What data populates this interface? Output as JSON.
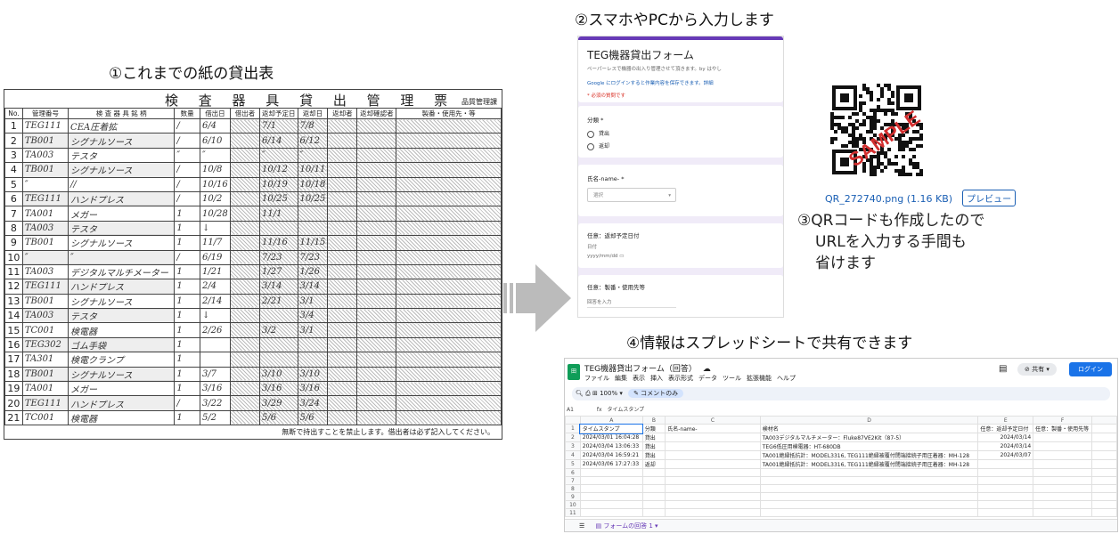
{
  "headings": {
    "paper": "①これまでの紙の貸出表",
    "form": "②スマホやPCから入力します",
    "qr_note": [
      "③QRコードも作成したので",
      "URLを入力する手間も",
      "省けます"
    ],
    "sheet": "④情報はスプレッドシートで共有できます"
  },
  "ledger": {
    "title": "検 査 器 具 貸 出 管 理 票",
    "dept": "品質管理課",
    "columns": [
      "No.",
      "管理番号",
      "検 査 器 具 銘 柄",
      "数量",
      "借出日",
      "借出者",
      "返却予定日",
      "返却日",
      "返却者",
      "返却確認者",
      "製番・使用先・等"
    ],
    "rows": [
      {
        "no": "1",
        "id": "TEG111",
        "item": "CEA圧着拡",
        "qty": "/",
        "date": "6/4",
        "due": "7/1",
        "ret": "7/8"
      },
      {
        "no": "2",
        "id": "TB001",
        "item": "シグナルソース",
        "qty": "/",
        "date": "6/10",
        "due": "6/14",
        "ret": "6/12"
      },
      {
        "no": "3",
        "id": "TA003",
        "item": "テスタ",
        "qty": "″",
        "date": "″",
        "due": "″",
        "ret": "″"
      },
      {
        "no": "4",
        "id": "TB001",
        "item": "シグナルソース",
        "qty": "/",
        "date": "10/8",
        "due": "10/12",
        "ret": "10/11"
      },
      {
        "no": "5",
        "id": "″",
        "item": "//",
        "qty": "/",
        "date": "10/16",
        "due": "10/19",
        "ret": "10/18"
      },
      {
        "no": "6",
        "id": "TEG111",
        "item": "ハンドプレス",
        "qty": "/",
        "date": "10/2",
        "due": "10/25",
        "ret": "10/25"
      },
      {
        "no": "7",
        "id": "TA001",
        "item": "メガー",
        "qty": "1",
        "date": "10/28",
        "due": "11/1",
        "ret": ""
      },
      {
        "no": "8",
        "id": "TA003",
        "item": "テスタ",
        "qty": "1",
        "date": "↓",
        "due": "",
        "ret": ""
      },
      {
        "no": "9",
        "id": "TB001",
        "item": "シグナルソース",
        "qty": "1",
        "date": "11/7",
        "due": "11/16",
        "ret": "11/15"
      },
      {
        "no": "10",
        "id": "″",
        "item": "″",
        "qty": "/",
        "date": "6/19",
        "due": "7/23",
        "ret": "7/23"
      },
      {
        "no": "11",
        "id": "TA003",
        "item": "デジタルマルチメーター",
        "qty": "1",
        "date": "1/21",
        "due": "1/27",
        "ret": "1/26"
      },
      {
        "no": "12",
        "id": "TEG111",
        "item": "ハンドプレス",
        "qty": "1",
        "date": "2/4",
        "due": "3/14",
        "ret": "3/14"
      },
      {
        "no": "13",
        "id": "TB001",
        "item": "シグナルソース",
        "qty": "1",
        "date": "2/14",
        "due": "2/21",
        "ret": "3/1"
      },
      {
        "no": "14",
        "id": "TA003",
        "item": "テスタ",
        "qty": "1",
        "date": "↓",
        "due": "",
        "ret": "3/4"
      },
      {
        "no": "15",
        "id": "TC001",
        "item": "検電器",
        "qty": "1",
        "date": "2/26",
        "due": "3/2",
        "ret": "3/1"
      },
      {
        "no": "16",
        "id": "TEG302",
        "item": "ゴム手袋",
        "qty": "1",
        "date": "",
        "due": "",
        "ret": ""
      },
      {
        "no": "17",
        "id": "TA301",
        "item": "検電クランプ",
        "qty": "1",
        "date": "",
        "due": "",
        "ret": ""
      },
      {
        "no": "18",
        "id": "TB001",
        "item": "シグナルソース",
        "qty": "1",
        "date": "3/7",
        "due": "3/10",
        "ret": "3/10"
      },
      {
        "no": "19",
        "id": "TA001",
        "item": "メガー",
        "qty": "1",
        "date": "3/16",
        "due": "3/16",
        "ret": "3/16"
      },
      {
        "no": "20",
        "id": "TEG111",
        "item": "ハンドプレス",
        "qty": "/",
        "date": "3/22",
        "due": "3/29",
        "ret": "3/24"
      },
      {
        "no": "21",
        "id": "TC001",
        "item": "検電器",
        "qty": "1",
        "date": "5/2",
        "due": "5/6",
        "ret": "5/6"
      }
    ],
    "footer": "無断で持出すことを禁止します。借出者は必ず記入してください。"
  },
  "form": {
    "title": "TEG機器貸出フォーム",
    "desc": "ペーパーレスで機器の出入り管理させて頂きます。by はやし",
    "login_note": "Google にログインすると作業内容を保存できます。詳細",
    "required": "* 必須の質問です",
    "q1": "分類 *",
    "options": [
      "貸出",
      "返却"
    ],
    "q2": "氏名-name- *",
    "select_placeholder": "選択",
    "q3": "任意：返却予定日付",
    "date_label": "日付",
    "date_placeholder": "yyyy/mm/dd",
    "q4": "任意：製番・使用先等",
    "answer_placeholder": "回答を入力"
  },
  "qr": {
    "stamp": "SAMPLE",
    "filename": "QR_272740.png (1.16 KB)",
    "preview": "プレビュー"
  },
  "sheet": {
    "title": "TEG機器貸出フォーム（回答）",
    "menu": [
      "ファイル",
      "編集",
      "表示",
      "挿入",
      "表示形式",
      "データ",
      "ツール",
      "拡張機能",
      "ヘルプ"
    ],
    "zoom": "100%",
    "comment_btn": "コメントのみ",
    "share": "共有",
    "login": "ログイン",
    "cell_ref": "A1",
    "formula": "タイムスタンプ",
    "col_letters": [
      "A",
      "B",
      "C",
      "D",
      "E",
      "F"
    ],
    "header": [
      "タイムスタンプ",
      "分類",
      "氏名-name-",
      "検材名",
      "任意：返却予定日付",
      "任意：製番・使用先等"
    ],
    "rows": [
      [
        "2024/03/01 16:04:28",
        "貸出",
        "",
        "TA003デジタルマルチメーター：Fluke87VE2Kit（87-5）",
        "2024/03/14",
        ""
      ],
      [
        "2024/03/04 13:06:33",
        "貸出",
        "",
        "TEG6低圧用検電器：HT-680DB",
        "2024/03/14",
        ""
      ],
      [
        "2024/03/04 16:59:21",
        "貸出",
        "",
        "TA001絶縁抵抗計：MODEL3316, TEG111絶縁被覆付閉端接続子用圧着器：MH-128",
        "2024/03/07",
        ""
      ],
      [
        "2024/03/06 17:27:33",
        "返却",
        "",
        "TA001絶縁抵抗計：MODEL3316, TEG111絶縁被覆付閉端接続子用圧着器：MH-128",
        "",
        ""
      ]
    ],
    "row_numbers": [
      "1",
      "2",
      "3",
      "4",
      "5",
      "6",
      "7",
      "8",
      "9",
      "10",
      "11"
    ],
    "sheet_tab": "フォームの回答 1"
  },
  "colors": {
    "accent": "#673ab7",
    "link": "#1a5fb4",
    "sheets_green": "#0f9d58",
    "login_blue": "#1a73e8"
  },
  "icons": [
    "right-arrow-icon",
    "qr-code-icon",
    "sheets-logo-icon",
    "radio-icon",
    "dropdown-icon"
  ]
}
